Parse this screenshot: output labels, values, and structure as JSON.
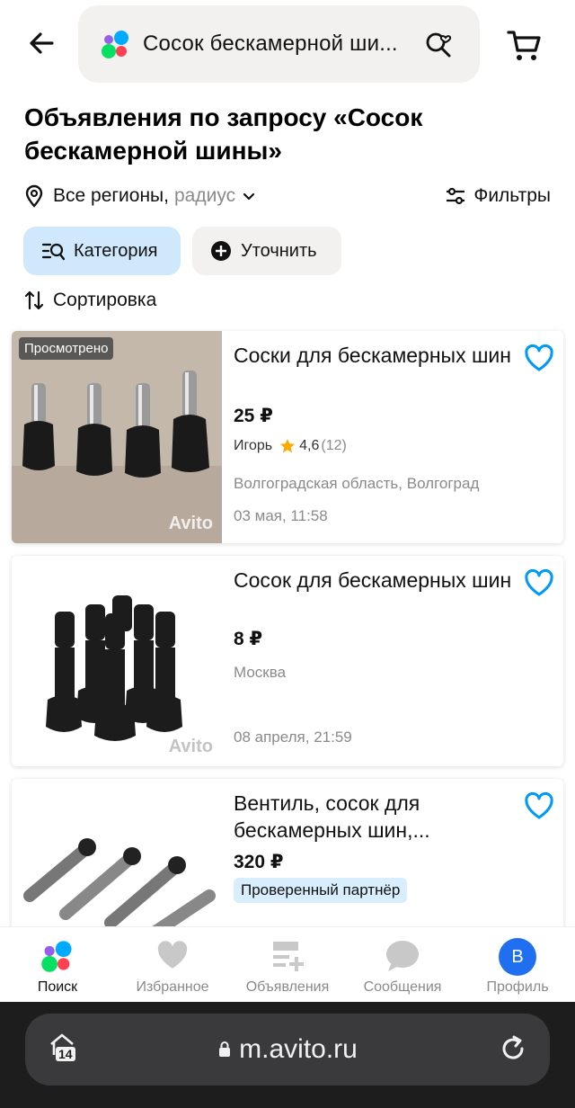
{
  "search": {
    "query": "Сосок бескамерной ши..."
  },
  "page": {
    "title": "Объявления по запросу «Сосок бескамерной шины»"
  },
  "region": {
    "label": "Все регионы,",
    "radius_label": "радиус"
  },
  "filters": {
    "label": "Фильтры"
  },
  "chips": {
    "category": "Категория",
    "refine": "Уточнить"
  },
  "sort": {
    "label": "Сортировка"
  },
  "listings": [
    {
      "badge": "Просмотрено",
      "title": "Соски для бескамерных шин",
      "price": "25 ₽",
      "seller": "Игорь",
      "rating": "4,6",
      "reviews": "(12)",
      "location": "Волгоградская область, Волгоград",
      "date": "03 мая, 11:58",
      "watermark": "Avito"
    },
    {
      "title": "Сосок для бескамерных шин",
      "price": "8 ₽",
      "location": "Москва",
      "date": "08 апреля, 21:59",
      "watermark": "Avito"
    },
    {
      "title": "Вентиль, сосок для бескамерных шин,...",
      "price": "320 ₽",
      "partner_badge": "Проверенный партнёр"
    }
  ],
  "bottom_nav": [
    {
      "label": "Поиск",
      "icon": "avito-logo-icon",
      "active": true
    },
    {
      "label": "Избранное",
      "icon": "heart-icon",
      "active": false
    },
    {
      "label": "Объявления",
      "icon": "add-listing-icon",
      "active": false
    },
    {
      "label": "Сообщения",
      "icon": "chat-icon",
      "active": false
    },
    {
      "label": "Профиль",
      "icon": "avatar",
      "active": false,
      "avatar_letter": "В"
    }
  ],
  "browser": {
    "url": "m.avito.ru",
    "tabs_count": "14"
  },
  "colors": {
    "accent_blue": "#0099f7",
    "chip_active_bg": "#cfe8fb",
    "avatar_bg": "#1f6ff0",
    "star": "#ffa800"
  }
}
